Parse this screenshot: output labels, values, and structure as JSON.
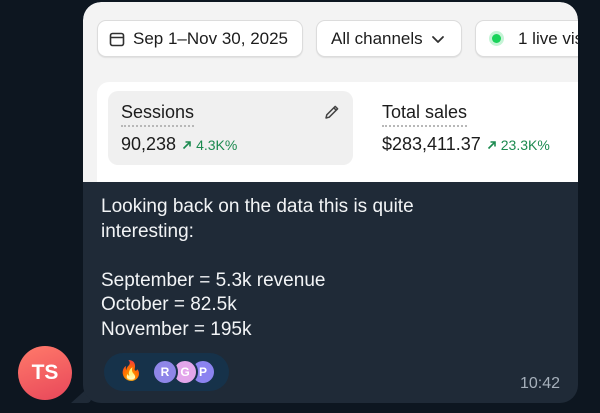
{
  "screenshot": {
    "date_range": "Sep 1–Nov 30, 2025",
    "channels": "All channels",
    "live_visitors": "1 live vis",
    "metrics": [
      {
        "label": "Sessions",
        "value": "90,238",
        "change": "4.3K%"
      },
      {
        "label": "Total sales",
        "value": "$283,411.37",
        "change": "23.3K%"
      }
    ]
  },
  "message": {
    "lines": [
      "Looking back on the data this is quite",
      "interesting:",
      "",
      "September = 5.3k revenue",
      "October = 82.5k",
      "November = 195k"
    ],
    "reaction_emoji": "🔥",
    "reactor_initials": [
      "R",
      "G",
      "P"
    ],
    "time": "10:42"
  },
  "sender": {
    "initials": "TS"
  },
  "icons": [
    "calendar-icon",
    "chevron-down-icon",
    "live-dot-icon",
    "pencil-icon",
    "arrow-up-right-icon"
  ],
  "colors": {
    "chat_background": "#0d1620",
    "bubble": "#1f2a37",
    "positive_change": "#1b8a4f",
    "live_dot": "#19d35a",
    "avatar": "#f25a5f",
    "reaction_pill": "#16324a"
  }
}
